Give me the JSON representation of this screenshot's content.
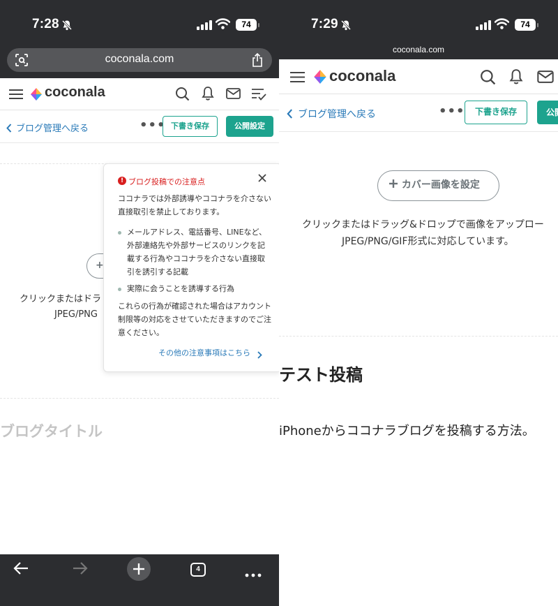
{
  "colors": {
    "accent": "#1da38e",
    "link": "#2a7ab8",
    "warning": "#d81e1e",
    "chrome": "#2c2d30"
  },
  "left": {
    "status": {
      "time": "7:28",
      "battery": "74"
    },
    "url": "coconala.com",
    "brand": "coconala",
    "toolbar": {
      "back": "ブログ管理へ戻る",
      "more": "•••",
      "draft": "下書き保存",
      "publish": "公開設定"
    },
    "cover_button_partial": "+",
    "cover_help": [
      "クリックまたはドラ",
      "JPEG/PNG"
    ],
    "popup": {
      "title": "ブログ投稿での注意点",
      "alert_icon": "!",
      "intro": "ココナラでは外部誘導やココナラを介さない直接取引を禁止しております。",
      "items": [
        "メールアドレス、電話番号、LINEなど、外部連絡先や外部サービスのリンクを記載する行為やココナラを介さない直接取引を誘引する記載",
        "実際に会うことを誘導する行為"
      ],
      "outro": "これらの行為が確認された場合はアカウント制限等の対応をさせていただきますのでご注意ください。",
      "link": "その他の注意事項はこちら"
    },
    "title_placeholder": "ブログタイトル",
    "tabs_count": "4"
  },
  "right": {
    "status": {
      "time": "7:29",
      "battery": "74"
    },
    "url": "coconala.com",
    "brand": "coconala",
    "toolbar": {
      "back": "ブログ管理へ戻る",
      "more": "•••",
      "draft": "下書き保存",
      "publish": "公開"
    },
    "cover_button": "カバー画像を設定",
    "cover_help": [
      "クリックまたはドラッグ&ドロップで画像をアップロー",
      "JPEG/PNG/GIF形式に対応しています。"
    ],
    "post_title": "テスト投稿",
    "post_body": "iPhoneからココナラブログを投稿する方法。"
  }
}
